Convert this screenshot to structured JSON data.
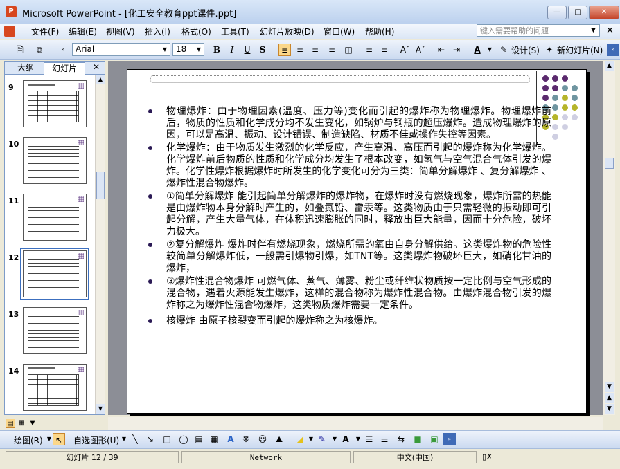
{
  "window": {
    "title": "Microsoft PowerPoint - [化工安全教育ppt课件.ppt]",
    "app_icon": "P"
  },
  "menu": {
    "items": [
      "文件(F)",
      "编辑(E)",
      "视图(V)",
      "插入(I)",
      "格式(O)",
      "工具(T)",
      "幻灯片放映(D)",
      "窗口(W)",
      "帮助(H)"
    ],
    "help_placeholder": "键入需要帮助的问题"
  },
  "toolbar": {
    "font": "Arial",
    "font_size": "18",
    "design_label": "设计(S)",
    "new_slide_label": "新幻灯片(N)"
  },
  "left_pane": {
    "tabs": [
      "大纲",
      "幻灯片"
    ],
    "thumbnails": [
      {
        "number": "9",
        "type": "table"
      },
      {
        "number": "10",
        "type": "text"
      },
      {
        "number": "11",
        "type": "text"
      },
      {
        "number": "12",
        "type": "text",
        "selected": true
      },
      {
        "number": "13",
        "type": "text"
      },
      {
        "number": "14",
        "type": "table"
      }
    ]
  },
  "slide": {
    "bullets": [
      "物理爆炸：由于物理因素(温度、压力等)变化而引起的爆炸称为物理爆炸。物理爆炸前后，物质的性质和化学成分均不发生变化，如锅炉与钢瓶的超压爆炸。造成物理爆炸的原因，可以是高温、振动、设计错误、制造缺陷、材质不佳或操作失控等因素。",
      "化学爆炸：由于物质发生激烈的化学反应，产生高温、高压而引起的爆炸称为化学爆炸。化学爆炸前后物质的性质和化学成分均发生了根本改变，如氢气与空气混合气体引发的爆炸。化学性爆炸根据爆炸时所发生的化学变化可分为三类：简单分解爆炸 、复分解爆炸 、爆炸性混合物爆炸。",
      "①简单分解爆炸  能引起简单分解爆炸的爆炸物，在爆炸时没有燃烧现象，爆炸所需的热能是由爆炸物本身分解时产生的，如叠氮铅、雷汞等。这类物质由于只需轻微的振动即可引起分解，产生大量气体，在体积迅速膨胀的同时，释放出巨大能量，因而十分危险，破坏力极大。",
      "②复分解爆炸  爆炸时伴有燃烧现象，燃烧所需的氧由自身分解供给。这类爆炸物的危险性较简单分解爆炸低，一般需引爆物引爆，如TNT等。这类爆炸物破坏巨大，如硝化甘油的爆炸，",
      "③爆炸性混合物爆炸  可燃气体、蒸气、薄雾、粉尘或纤维状物质按一定比例与空气形成的混合物，遇着火源能发生爆炸，这样的混合物称为爆炸性混合物。由爆炸混合物引发的爆炸称之为爆炸性混合物爆炸，这类物质爆炸需要一定条件。",
      "核爆炸  由原子核裂变而引起的爆炸称之为核爆炸。"
    ]
  },
  "drawing_toolbar": {
    "draw_label": "绘图(R)",
    "autoshapes_label": "自选图形(U)"
  },
  "status": {
    "slide_info": "幻灯片 12 / 39",
    "theme": "Network",
    "language": "中文(中国)"
  }
}
